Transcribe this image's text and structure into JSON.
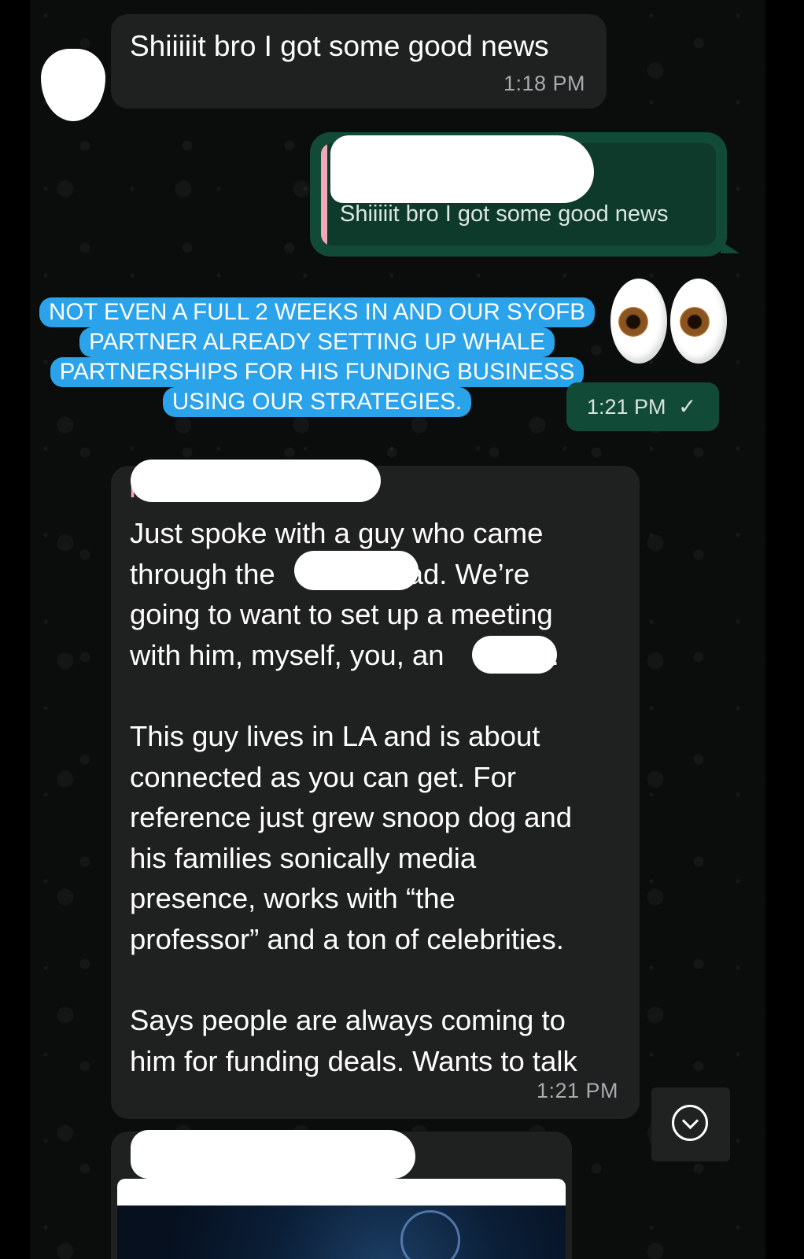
{
  "messages": [
    {
      "text": "Shiiiiit bro I got some good news",
      "time": "1:18 PM"
    },
    {
      "quoted_text": "Shiiiiit bro I got some good news"
    },
    {
      "caption_lines": [
        "NOT EVEN A FULL 2 WEEKS IN AND OUR SYOFB",
        "PARTNER ALREADY SETTING UP WHALE",
        "PARTNERSHIPS FOR HIS FUNDING BUSINESS",
        "USING OUR STRATEGIES."
      ],
      "emoji": "eyes",
      "time": "1:21 PM",
      "status_icon": "check-icon",
      "status_glyph": "✓"
    },
    {
      "paragraph1_lines": [
        "Just spoke with a guy who came",
        "through the",
        "ad. We’re",
        "going to want to set up a meeting",
        "with him, myself, you, an",
        "."
      ],
      "paragraph2_lines": [
        "This guy lives in LA and is about",
        "connected as you can get. For",
        "reference just grew snoop dog and",
        "his families sonically media",
        "presence, works with “the",
        "professor” and a ton of celebrities."
      ],
      "paragraph3_lines": [
        "Says people are always coming to",
        "him for funding deals. Wants to talk"
      ],
      "time": "1:21 PM"
    },
    {
      "link_preview_icon": "link-preview-image"
    }
  ],
  "scroll_button_icon": "chevron-down-icon",
  "colors": {
    "background": "#0b0c0c",
    "incoming_bubble": "#1f2020",
    "outgoing_bubble": "#124a38",
    "caption_highlight": "#2ba3ea",
    "author_name": "#f2a7b9",
    "redaction": "#ffffff"
  }
}
